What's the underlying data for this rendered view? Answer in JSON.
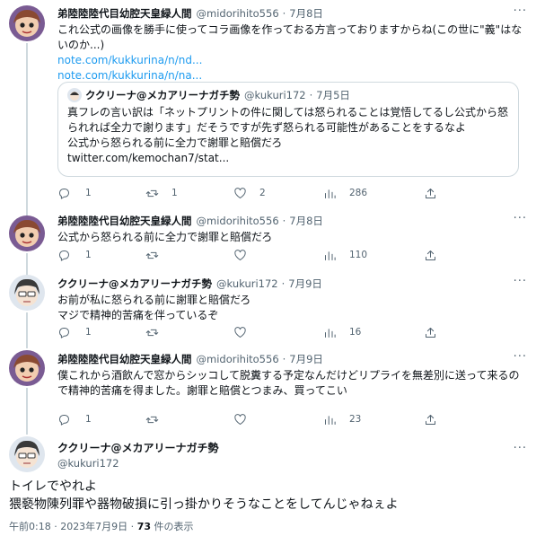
{
  "users": {
    "a": {
      "name": "弟陸陸陸代目幼腔天皇緑人間",
      "handle": "@midorihito556"
    },
    "b": {
      "name": "ククリーナ@メカアリーナガチ勢",
      "handle": "@kukuri172"
    }
  },
  "tweets": [
    {
      "user": "a",
      "time": "7月8日",
      "lines": [
        "これ公式の画像を勝手に使ってコラ画像を作っておる方言っておりますからね(この世に\"義\"はないのか...)"
      ],
      "links": [
        "note.com/kukkurina/n/nd...",
        "note.com/kukkurina/n/na..."
      ],
      "quote": {
        "user": "b",
        "time": "7月5日",
        "lines": [
          "真フレの言い訳は「ネットプリントの件に関しては怒られることは覚悟してるし公式から怒られれば全力で謝ります」だそうですが先ず怒られる可能性があることをするなよ",
          "公式から怒られる前に全力で謝罪と賠償だろ"
        ],
        "link": "twitter.com/kemochan7/stat..."
      },
      "stats": {
        "reply": "1",
        "retweet": "1",
        "like": "2",
        "views": "286"
      }
    },
    {
      "user": "a",
      "time": "7月8日",
      "lines": [
        "公式から怒られる前に全力で謝罪と賠償だろ"
      ],
      "stats": {
        "reply": "1",
        "retweet": "",
        "like": "",
        "views": "110"
      }
    },
    {
      "user": "b",
      "time": "7月9日",
      "lines": [
        "お前が私に怒られる前に謝罪と賠償だろ",
        "マジで精神的苦痛を伴っているぞ"
      ],
      "stats": {
        "reply": "1",
        "retweet": "",
        "like": "",
        "views": "16"
      }
    },
    {
      "user": "a",
      "time": "7月9日",
      "lines": [
        "僕これから酒飲んで窓からシッコして脱糞する予定なんだけどリプライを無差別に送って来るので精神的苦痛を得ました。謝罪と賠償とつまみ、買ってこい"
      ],
      "stats": {
        "reply": "1",
        "retweet": "",
        "like": "",
        "views": "23"
      }
    }
  ],
  "main": {
    "user": "b",
    "lines": [
      "トイレでやれよ",
      "猥褻物陳列罪や器物破損に引っ掛かりそうなことをしてんじゃねぇよ"
    ],
    "time": "午前0:18 · 2023年7月9日 ·",
    "views_count": "73",
    "views_label": "件の表示"
  },
  "icons": {
    "reply": "reply-icon",
    "retweet": "retweet-icon",
    "like": "heart-icon",
    "views": "views-icon",
    "share": "share-icon",
    "more": "more-icon"
  },
  "colors": {
    "link": "#1d9bf0",
    "muted": "#536471",
    "border": "#cfd9de",
    "text": "#0f1419"
  }
}
